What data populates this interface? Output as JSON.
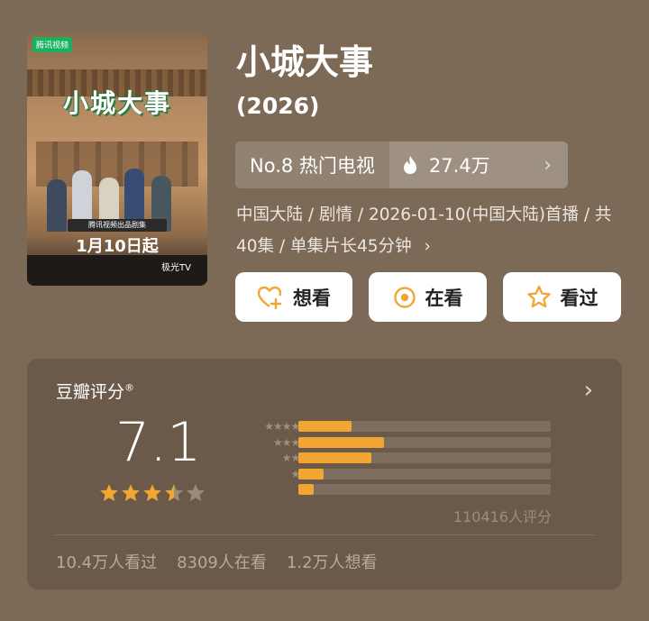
{
  "poster": {
    "platform_badge": "腾讯视频",
    "title": "小城大事",
    "band": "腾讯视频出品剧集",
    "date": "1月10日起",
    "channel": "极光TV"
  },
  "title": "小城大事",
  "year": "(2026)",
  "rank": {
    "label": "No.8 热门电视",
    "heat": "27.4万"
  },
  "meta": "中国大陆 / 剧情 / 2026-01-10(中国大陆)首播 / 共40集 / 单集片长45分钟",
  "meta_chevron": "›",
  "buttons": {
    "want": "想看",
    "watching": "在看",
    "watched": "看过"
  },
  "rating": {
    "title": "豆瓣评分",
    "reg": "®",
    "score": "7.1",
    "stars": 3.5,
    "distribution": [
      0.21,
      0.34,
      0.29,
      0.1,
      0.06
    ],
    "count": "110416人评分"
  },
  "stats": {
    "watched": "10.4万人看过",
    "watching": "8309人在看",
    "want": "1.2万人想看"
  },
  "colors": {
    "accent": "#f2a632",
    "background": "#7d6a56",
    "card": "#6b5a4a"
  },
  "icons": [
    "heart-plus-icon",
    "target-icon",
    "star-icon",
    "fire-icon",
    "chevron-right-icon"
  ]
}
